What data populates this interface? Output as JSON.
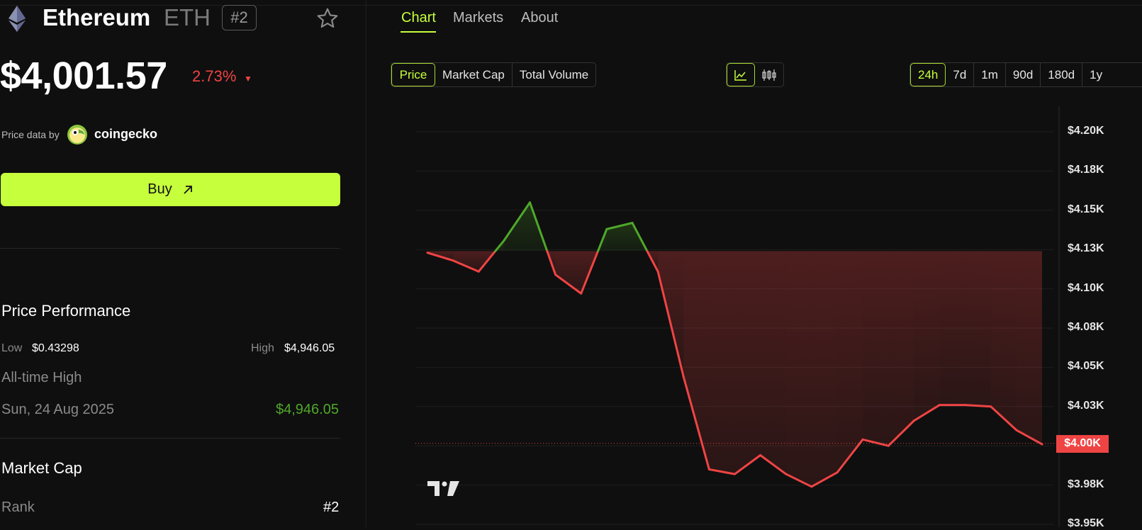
{
  "header": {
    "coin_name": "Ethereum",
    "coin_symbol": "ETH",
    "rank_badge": "#2"
  },
  "price": {
    "value": "$4,001.57",
    "change": "2.73%",
    "change_direction": "down"
  },
  "source": {
    "label": "Price data by",
    "provider": "coingecko"
  },
  "buy": {
    "label": "Buy"
  },
  "performance": {
    "title": "Price Performance",
    "low_label": "Low",
    "low_value": "$0.43298",
    "high_label": "High",
    "high_value": "$4,946.05",
    "ath_label": "All-time High",
    "ath_date": "Sun, 24 Aug 2025",
    "ath_value": "$4,946.05"
  },
  "market_cap": {
    "title": "Market Cap",
    "rank_label": "Rank",
    "rank_value": "#2"
  },
  "nav": {
    "tabs": [
      {
        "label": "Chart",
        "active": true
      },
      {
        "label": "Markets",
        "active": false
      },
      {
        "label": "About",
        "active": false
      }
    ]
  },
  "metric_toggle": {
    "options": [
      {
        "label": "Price",
        "active": true
      },
      {
        "label": "Market Cap",
        "active": false
      },
      {
        "label": "Total Volume",
        "active": false
      }
    ]
  },
  "chart_type_toggle": {
    "options": [
      {
        "icon": "line-chart-icon",
        "active": true
      },
      {
        "icon": "candlestick-icon",
        "active": false
      }
    ]
  },
  "range_toggle": {
    "options": [
      {
        "label": "24h",
        "active": true
      },
      {
        "label": "7d",
        "active": false
      },
      {
        "label": "1m",
        "active": false
      },
      {
        "label": "90d",
        "active": false
      },
      {
        "label": "180d",
        "active": false
      },
      {
        "label": "1y",
        "active": false
      }
    ]
  },
  "colors": {
    "accent": "#c6ff3c",
    "up": "#4fa82a",
    "down": "#ef4444",
    "background": "#0f0f0f"
  },
  "chart_data": {
    "type": "line",
    "y_tick_labels": [
      "$4.20K",
      "$4.18K",
      "$4.15K",
      "$4.13K",
      "$4.10K",
      "$4.08K",
      "$4.05K",
      "$4.03K",
      "$4.00K",
      "$3.98K",
      "$3.95K"
    ],
    "y_ticks": [
      4200,
      4175,
      4150,
      4125,
      4100,
      4075,
      4050,
      4025,
      4000,
      3975,
      3950
    ],
    "ylim": [
      3950,
      4200
    ],
    "baseline": 4124,
    "current_price_label": "$4.00K",
    "current_price": 4001.57,
    "grid": true,
    "values": [
      4123,
      4118,
      4111,
      4131,
      4155,
      4109,
      4097,
      4138,
      4142,
      4111,
      4044,
      3985,
      3982,
      3994,
      3982,
      3974,
      3983,
      4004,
      4000,
      4016,
      4026,
      4026,
      4025,
      4010,
      4001
    ]
  }
}
